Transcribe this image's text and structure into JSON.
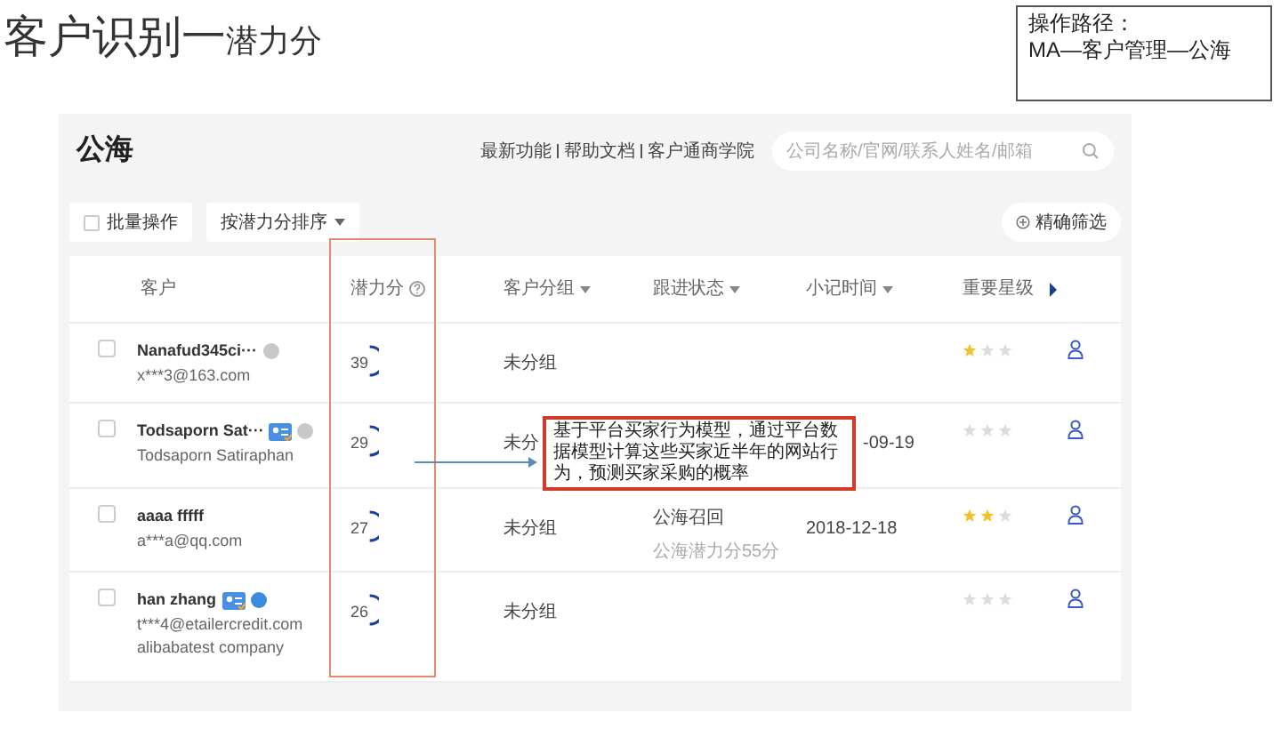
{
  "title": {
    "main": "客户识别一",
    "suffix": "潜力分"
  },
  "path_box": {
    "label": "操作路径：",
    "path": "MA—客户管理—公海"
  },
  "panel": {
    "heading": "公海",
    "links": [
      "最新功能",
      "帮助文档",
      "客户通商学院"
    ],
    "search": {
      "placeholder": "公司名称/官网/联系人姓名/邮箱"
    },
    "toolbar": {
      "batch": {
        "label": "批量操作",
        "checked": false
      },
      "sort": "按潜力分排序",
      "filter": "精确筛选"
    }
  },
  "table": {
    "columns": [
      {
        "label": "客户",
        "kind": "plain"
      },
      {
        "label": "潜力分",
        "kind": "help"
      },
      {
        "label": "客户分组",
        "kind": "sort"
      },
      {
        "label": "跟进状态",
        "kind": "sort"
      },
      {
        "label": "小记时间",
        "kind": "sort"
      },
      {
        "label": "重要星级",
        "kind": "more"
      }
    ],
    "rows": [
      {
        "checked": false,
        "name": "Nanafud345ci···",
        "lines": [
          "x***3@163.com"
        ],
        "badges": [
          {
            "kind": "gray-dot"
          }
        ],
        "score": "39",
        "group": "未分组",
        "stars": 1
      },
      {
        "checked": false,
        "name": "Todsaporn Sat···",
        "lines": [
          "Todsaporn Satiraphan"
        ],
        "badges": [
          {
            "kind": "card"
          },
          {
            "kind": "gray-dot"
          }
        ],
        "score": "29",
        "group": "未分",
        "time": "-09-19",
        "stars": 0
      },
      {
        "checked": false,
        "name": "aaaa fffff",
        "lines": [
          "a***a@qq.com"
        ],
        "badges": [],
        "score": "27",
        "group": "未分组",
        "status": "公海召回",
        "status_note": "公海潜力分55分",
        "time": "2018-12-18",
        "stars": 2
      },
      {
        "checked": false,
        "name": "han zhang",
        "lines": [
          "t***4@etailercredit.com",
          "alibabatest company"
        ],
        "badges": [
          {
            "kind": "card"
          },
          {
            "kind": "blue-dot"
          }
        ],
        "score": "26",
        "group": "未分组",
        "stars": 0
      }
    ]
  },
  "callout": "基于平台买家行为模型，通过平台数据模型计算这些买家近半年的网站行为，预测买家采购的概率"
}
